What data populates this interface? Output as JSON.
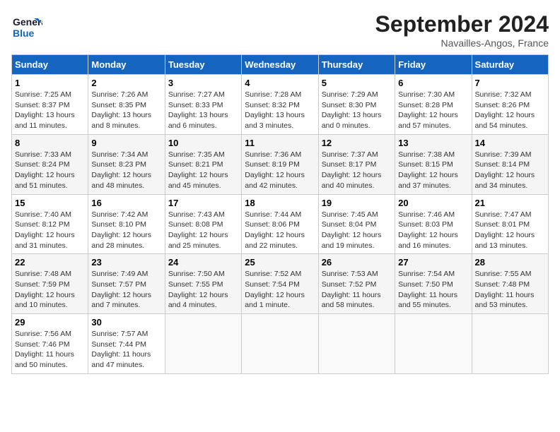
{
  "logo": {
    "line1": "General",
    "line2": "Blue"
  },
  "title": "September 2024",
  "subtitle": "Navailles-Angos, France",
  "days_header": [
    "Sunday",
    "Monday",
    "Tuesday",
    "Wednesday",
    "Thursday",
    "Friday",
    "Saturday"
  ],
  "weeks": [
    [
      {
        "day": 1,
        "sunrise": "7:25 AM",
        "sunset": "8:37 PM",
        "daylight": "13 hours and 11 minutes."
      },
      {
        "day": 2,
        "sunrise": "7:26 AM",
        "sunset": "8:35 PM",
        "daylight": "13 hours and 8 minutes."
      },
      {
        "day": 3,
        "sunrise": "7:27 AM",
        "sunset": "8:33 PM",
        "daylight": "13 hours and 6 minutes."
      },
      {
        "day": 4,
        "sunrise": "7:28 AM",
        "sunset": "8:32 PM",
        "daylight": "13 hours and 3 minutes."
      },
      {
        "day": 5,
        "sunrise": "7:29 AM",
        "sunset": "8:30 PM",
        "daylight": "13 hours and 0 minutes."
      },
      {
        "day": 6,
        "sunrise": "7:30 AM",
        "sunset": "8:28 PM",
        "daylight": "12 hours and 57 minutes."
      },
      {
        "day": 7,
        "sunrise": "7:32 AM",
        "sunset": "8:26 PM",
        "daylight": "12 hours and 54 minutes."
      }
    ],
    [
      {
        "day": 8,
        "sunrise": "7:33 AM",
        "sunset": "8:24 PM",
        "daylight": "12 hours and 51 minutes."
      },
      {
        "day": 9,
        "sunrise": "7:34 AM",
        "sunset": "8:23 PM",
        "daylight": "12 hours and 48 minutes."
      },
      {
        "day": 10,
        "sunrise": "7:35 AM",
        "sunset": "8:21 PM",
        "daylight": "12 hours and 45 minutes."
      },
      {
        "day": 11,
        "sunrise": "7:36 AM",
        "sunset": "8:19 PM",
        "daylight": "12 hours and 42 minutes."
      },
      {
        "day": 12,
        "sunrise": "7:37 AM",
        "sunset": "8:17 PM",
        "daylight": "12 hours and 40 minutes."
      },
      {
        "day": 13,
        "sunrise": "7:38 AM",
        "sunset": "8:15 PM",
        "daylight": "12 hours and 37 minutes."
      },
      {
        "day": 14,
        "sunrise": "7:39 AM",
        "sunset": "8:14 PM",
        "daylight": "12 hours and 34 minutes."
      }
    ],
    [
      {
        "day": 15,
        "sunrise": "7:40 AM",
        "sunset": "8:12 PM",
        "daylight": "12 hours and 31 minutes."
      },
      {
        "day": 16,
        "sunrise": "7:42 AM",
        "sunset": "8:10 PM",
        "daylight": "12 hours and 28 minutes."
      },
      {
        "day": 17,
        "sunrise": "7:43 AM",
        "sunset": "8:08 PM",
        "daylight": "12 hours and 25 minutes."
      },
      {
        "day": 18,
        "sunrise": "7:44 AM",
        "sunset": "8:06 PM",
        "daylight": "12 hours and 22 minutes."
      },
      {
        "day": 19,
        "sunrise": "7:45 AM",
        "sunset": "8:04 PM",
        "daylight": "12 hours and 19 minutes."
      },
      {
        "day": 20,
        "sunrise": "7:46 AM",
        "sunset": "8:03 PM",
        "daylight": "12 hours and 16 minutes."
      },
      {
        "day": 21,
        "sunrise": "7:47 AM",
        "sunset": "8:01 PM",
        "daylight": "12 hours and 13 minutes."
      }
    ],
    [
      {
        "day": 22,
        "sunrise": "7:48 AM",
        "sunset": "7:59 PM",
        "daylight": "12 hours and 10 minutes."
      },
      {
        "day": 23,
        "sunrise": "7:49 AM",
        "sunset": "7:57 PM",
        "daylight": "12 hours and 7 minutes."
      },
      {
        "day": 24,
        "sunrise": "7:50 AM",
        "sunset": "7:55 PM",
        "daylight": "12 hours and 4 minutes."
      },
      {
        "day": 25,
        "sunrise": "7:52 AM",
        "sunset": "7:54 PM",
        "daylight": "12 hours and 1 minute."
      },
      {
        "day": 26,
        "sunrise": "7:53 AM",
        "sunset": "7:52 PM",
        "daylight": "11 hours and 58 minutes."
      },
      {
        "day": 27,
        "sunrise": "7:54 AM",
        "sunset": "7:50 PM",
        "daylight": "11 hours and 55 minutes."
      },
      {
        "day": 28,
        "sunrise": "7:55 AM",
        "sunset": "7:48 PM",
        "daylight": "11 hours and 53 minutes."
      }
    ],
    [
      {
        "day": 29,
        "sunrise": "7:56 AM",
        "sunset": "7:46 PM",
        "daylight": "11 hours and 50 minutes."
      },
      {
        "day": 30,
        "sunrise": "7:57 AM",
        "sunset": "7:44 PM",
        "daylight": "11 hours and 47 minutes."
      },
      null,
      null,
      null,
      null,
      null
    ]
  ]
}
